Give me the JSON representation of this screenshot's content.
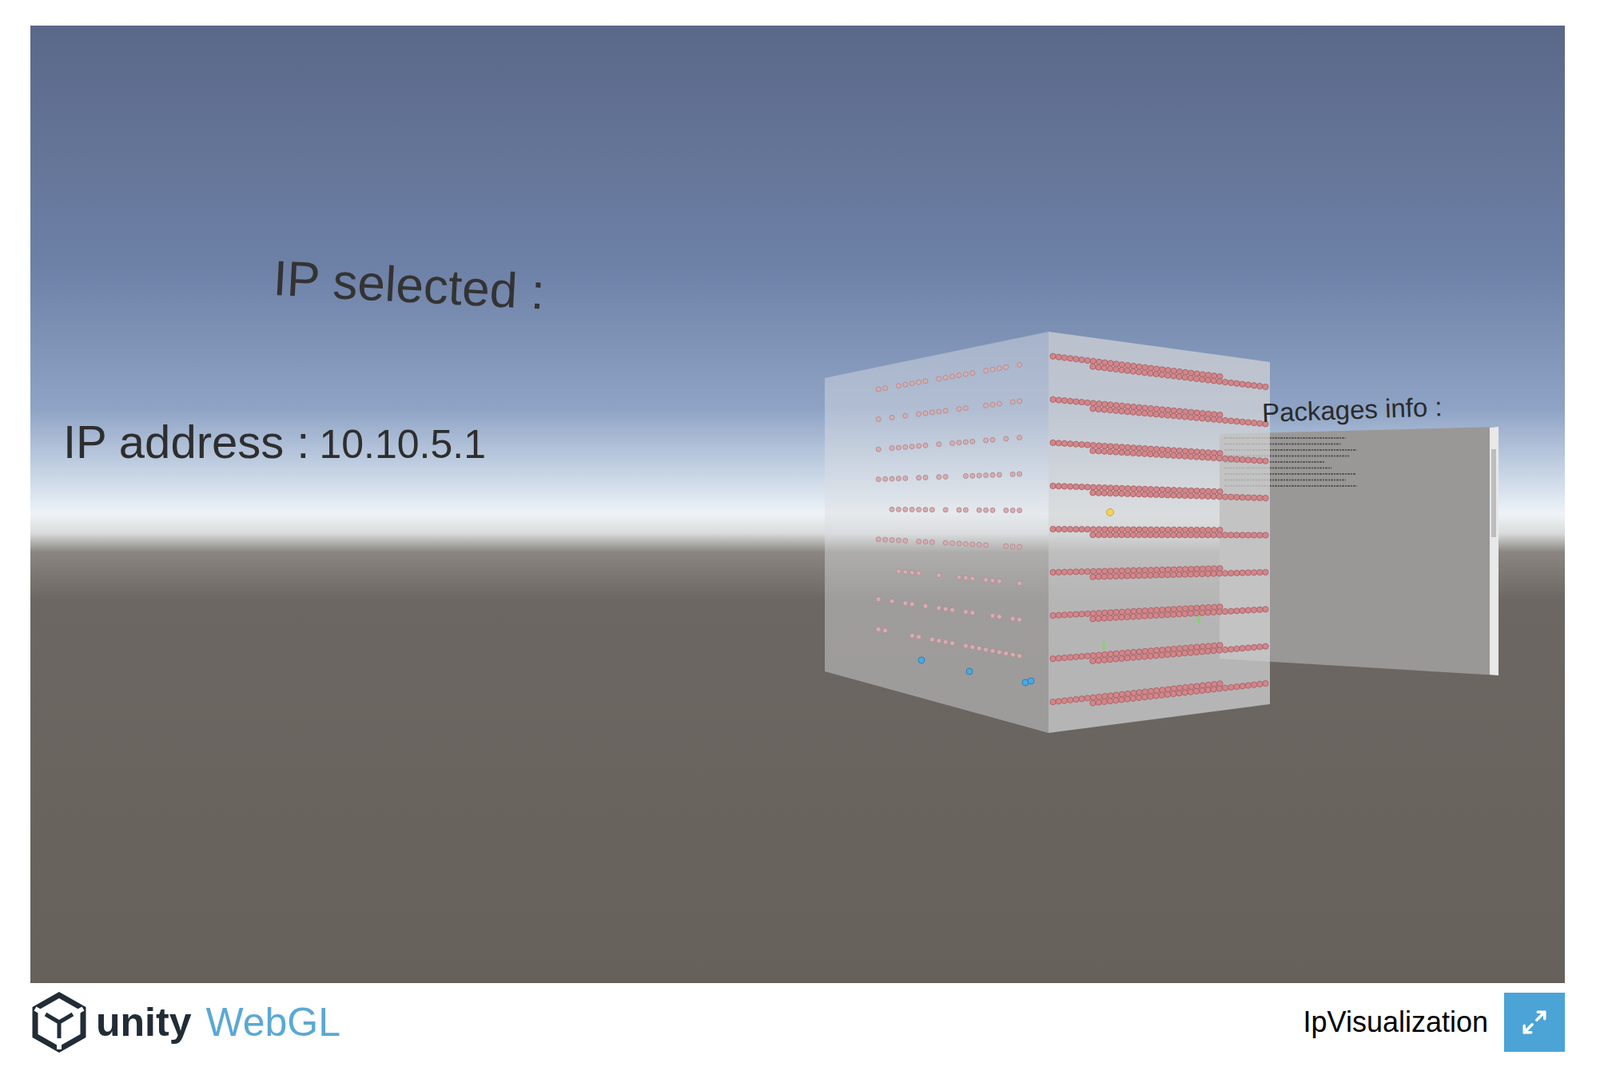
{
  "window": {
    "title": "IpVisualization"
  },
  "scene": {
    "selected_heading": "IP selected :",
    "ip_label": "IP address :",
    "ip_value": "10.10.5.1",
    "packages_heading": "Packages info :"
  },
  "point_kinds": [
    {
      "kind": "packet",
      "selected": false,
      "color": "#d3868a"
    },
    {
      "kind": "selected",
      "selected": true,
      "color": "#f3d35a"
    },
    {
      "kind": "flag",
      "selected": false,
      "color": "#84d36c"
    },
    {
      "kind": "host",
      "selected": false,
      "color": "#4ba9e3"
    }
  ],
  "footer": {
    "logo_word": "unity",
    "logo_product": "WebGL"
  }
}
